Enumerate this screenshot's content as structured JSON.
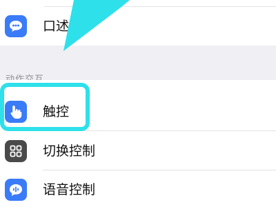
{
  "settings": {
    "rows_top": [
      {
        "label": "口述",
        "icon": "speech-bubble-icon",
        "icon_color": "#3a7bf7"
      }
    ],
    "section_header": "动作交互",
    "rows_bottom": [
      {
        "label": "触控",
        "icon": "hand-touch-icon",
        "icon_color": "#3a7bf7"
      },
      {
        "label": "切换控制",
        "icon": "grid-icon",
        "icon_color": "#4a4a4a"
      },
      {
        "label": "语音控制",
        "icon": "voice-control-icon",
        "icon_color": "#3a7bf7"
      }
    ]
  },
  "annotation": {
    "highlight_color": "#2ee0ea",
    "arrow_color": "#2ee0ea"
  }
}
